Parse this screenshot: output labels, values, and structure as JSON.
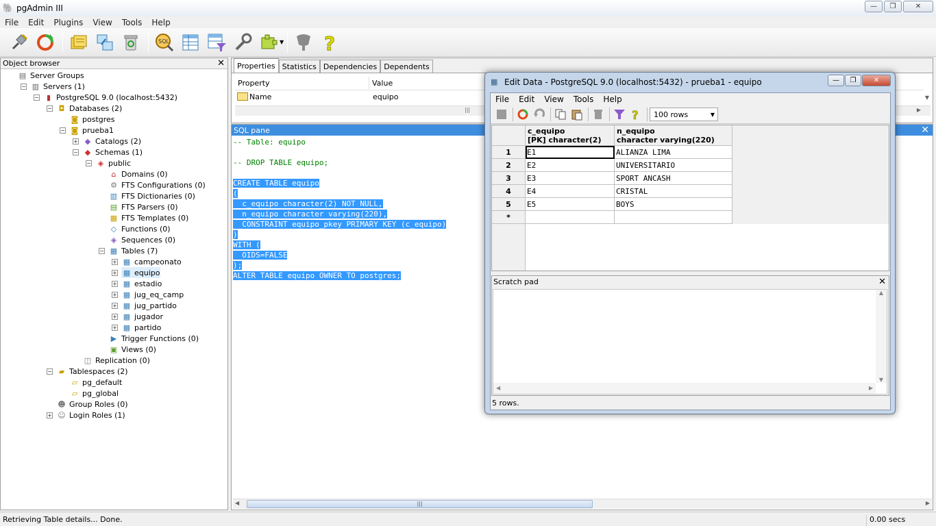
{
  "window": {
    "title": "pgAdmin III",
    "controls": {
      "minimize": "—",
      "maximize": "❐",
      "close": "✕"
    }
  },
  "menu": [
    "File",
    "Edit",
    "Plugins",
    "View",
    "Tools",
    "Help"
  ],
  "toolbar": {
    "buttons": [
      "connect-icon",
      "refresh-icon",
      "properties-icon",
      "create-object-icon",
      "drop-object-icon",
      "sql-query-icon",
      "view-data-icon",
      "filtered-data-icon",
      "maintenance-icon",
      "plugins-icon",
      "hint-icon",
      "help-icon"
    ]
  },
  "object_browser": {
    "title": "Object browser",
    "close": "✕",
    "items": [
      {
        "label": "Server Groups",
        "icon": "server-groups-icon"
      },
      {
        "label": "Servers (1)",
        "icon": "servers-icon"
      },
      {
        "label": "PostgreSQL 9.0 (localhost:5432)",
        "icon": "server-icon"
      },
      {
        "label": "Databases (2)",
        "icon": "databases-icon"
      },
      {
        "label": "postgres",
        "icon": "database-icon"
      },
      {
        "label": "prueba1",
        "icon": "database-icon"
      },
      {
        "label": "Catalogs (2)",
        "icon": "catalogs-icon"
      },
      {
        "label": "Schemas (1)",
        "icon": "schemas-icon"
      },
      {
        "label": "public",
        "icon": "schema-icon"
      },
      {
        "label": "Domains (0)",
        "icon": "domains-icon"
      },
      {
        "label": "FTS Configurations (0)",
        "icon": "fts-config-icon"
      },
      {
        "label": "FTS Dictionaries (0)",
        "icon": "fts-dict-icon"
      },
      {
        "label": "FTS Parsers (0)",
        "icon": "fts-parser-icon"
      },
      {
        "label": "FTS Templates (0)",
        "icon": "fts-template-icon"
      },
      {
        "label": "Functions (0)",
        "icon": "functions-icon"
      },
      {
        "label": "Sequences (0)",
        "icon": "sequences-icon"
      },
      {
        "label": "Tables (7)",
        "icon": "tables-icon"
      },
      {
        "label": "campeonato",
        "icon": "table-icon"
      },
      {
        "label": "equipo",
        "icon": "table-icon"
      },
      {
        "label": "estadio",
        "icon": "table-icon"
      },
      {
        "label": "jug_eq_camp",
        "icon": "table-icon"
      },
      {
        "label": "jug_partido",
        "icon": "table-icon"
      },
      {
        "label": "jugador",
        "icon": "table-icon"
      },
      {
        "label": "partido",
        "icon": "table-icon"
      },
      {
        "label": "Trigger Functions (0)",
        "icon": "trigger-functions-icon"
      },
      {
        "label": "Views (0)",
        "icon": "views-icon"
      },
      {
        "label": "Replication (0)",
        "icon": "replication-icon"
      },
      {
        "label": "Tablespaces (2)",
        "icon": "tablespaces-icon"
      },
      {
        "label": "pg_default",
        "icon": "tablespace-icon"
      },
      {
        "label": "pg_global",
        "icon": "tablespace-icon"
      },
      {
        "label": "Group Roles (0)",
        "icon": "group-roles-icon"
      },
      {
        "label": "Login Roles (1)",
        "icon": "login-roles-icon"
      }
    ]
  },
  "properties": {
    "tabs": [
      "Properties",
      "Statistics",
      "Dependencies",
      "Dependents"
    ],
    "active_tab": "Properties",
    "columns": [
      "Property",
      "Value"
    ],
    "rows": [
      {
        "property": "Name",
        "value": "equipo"
      }
    ]
  },
  "sql_pane": {
    "title": "SQL pane",
    "close": "✕",
    "lines": [
      "-- Table: equipo",
      "",
      "-- DROP TABLE equipo;",
      "",
      "CREATE TABLE equipo",
      "(",
      "  c_equipo character(2) NOT NULL,",
      "  n_equipo character varying(220),",
      "  CONSTRAINT equipo_pkey PRIMARY KEY (c_equipo)",
      ")",
      "WITH (",
      "  OIDS=FALSE",
      ");",
      "ALTER TABLE equipo OWNER TO postgres;"
    ]
  },
  "status": {
    "message": "Retrieving Table details... Done.",
    "time": "0.00 secs"
  },
  "edit_data": {
    "title": "Edit Data - PostgreSQL 9.0 (localhost:5432) - prueba1 - equipo",
    "menu": [
      "File",
      "Edit",
      "View",
      "Tools",
      "Help"
    ],
    "toolbar": [
      "save-icon",
      "refresh-icon",
      "undo-icon",
      "copy-icon",
      "paste-icon",
      "delete-icon",
      "filter-icon",
      "help-icon"
    ],
    "rows_limit": "100 rows",
    "columns": [
      {
        "name": "c_equipo",
        "type": "[PK] character(2)"
      },
      {
        "name": "n_equipo",
        "type": "character varying(220)"
      }
    ],
    "rows": [
      {
        "num": "1",
        "c_equipo": "E1",
        "n_equipo": "ALIANZA LIMA"
      },
      {
        "num": "2",
        "c_equipo": "E2",
        "n_equipo": "UNIVERSITARIO"
      },
      {
        "num": "3",
        "c_equipo": "E3",
        "n_equipo": "SPORT ANCASH"
      },
      {
        "num": "4",
        "c_equipo": "E4",
        "n_equipo": "CRISTAL"
      },
      {
        "num": "5",
        "c_equipo": "E5",
        "n_equipo": "BOYS"
      }
    ],
    "new_row_marker": "*",
    "scratch_pad_title": "Scratch pad",
    "scratch_close": "✕",
    "status": "5 rows."
  }
}
